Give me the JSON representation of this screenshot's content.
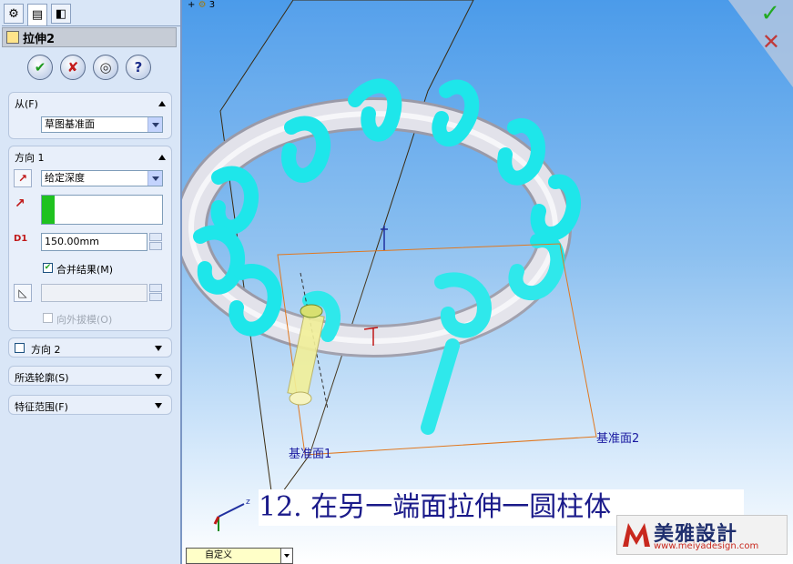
{
  "property_manager": {
    "title": "拉伸2",
    "tabs": [
      "feature-manager-icon",
      "property-manager-icon",
      "configuration-manager-icon"
    ],
    "actions": {
      "ok": "✔",
      "cancel": "✘",
      "detail_preview": "◎",
      "help": "?"
    },
    "from_group": {
      "header": "从(F)",
      "value": "草图基准面"
    },
    "direction1": {
      "header": "方向 1",
      "end_condition": "给定深度",
      "depth": "150.00mm",
      "merge_label": "合并结果(M)",
      "merge_checked": true,
      "draft_outward_label": "向外拔模(O)"
    },
    "direction2": {
      "header": "方向 2"
    },
    "selected_contours": {
      "header": "所选轮廓(S)"
    },
    "feature_scope": {
      "header": "特征范围(F)"
    }
  },
  "viewport": {
    "tree_item": "3",
    "plane1_label": "基准面1",
    "plane2_label": "基准面2",
    "caption": "12. 在另一端面拉伸一圆柱体",
    "view_orientation": "自定义",
    "logo_text": "美雅設計",
    "logo_url": "www.meiyadesign.com",
    "colors": {
      "spring": "#1ee6ea",
      "torus": "#dcdce4",
      "plane_edge": "#e07820"
    }
  }
}
